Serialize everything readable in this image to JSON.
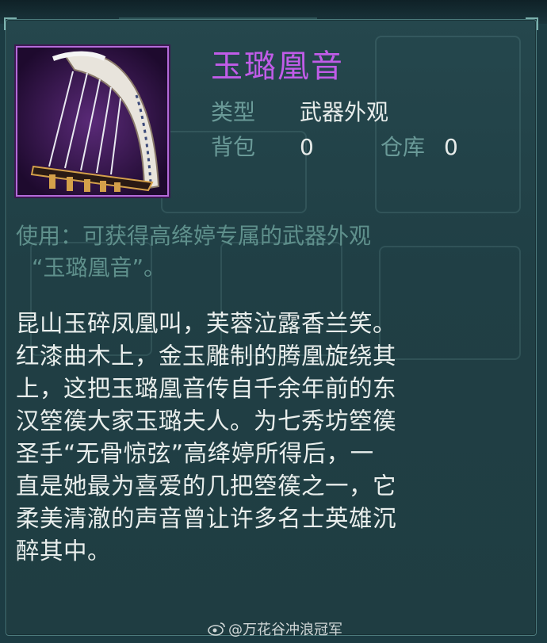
{
  "item": {
    "name": "玉璐凰音",
    "type_label": "类型",
    "type_value": "武器外观",
    "bag_label": "背包",
    "bag_count": "0",
    "storage_label": "仓库",
    "storage_count": "0"
  },
  "usage": {
    "line1": "使用：可获得高绛婷专属的武器外观",
    "line2": "“玉璐凰音”。"
  },
  "description": {
    "lines": [
      "昆山玉碎凤凰叫，芙蓉泣露香兰笑。",
      "红漆曲木上，金玉雕制的腾凰旋绕其",
      "上，这把玉璐凰音传自千余年前的东",
      "汉箜篌大家玉璐夫人。为七秀坊箜篌",
      "圣手“无骨惊弦”高绛婷所得后，一",
      "直是她最为喜爱的几把箜篌之一，它",
      "柔美清澈的声音曾让许多名士英雄沉",
      "醉其中。"
    ]
  },
  "watermark": {
    "text": "@万花谷冲浪冠军",
    "icon": "weibo-icon"
  },
  "colors": {
    "panel_bg": "#22434a",
    "item_name": "#c05ce8",
    "label": "#6a9a98",
    "value": "#e7ecea",
    "usage": "#5f908c",
    "description": "#e9eeec",
    "icon_border": "#b36ad9"
  }
}
